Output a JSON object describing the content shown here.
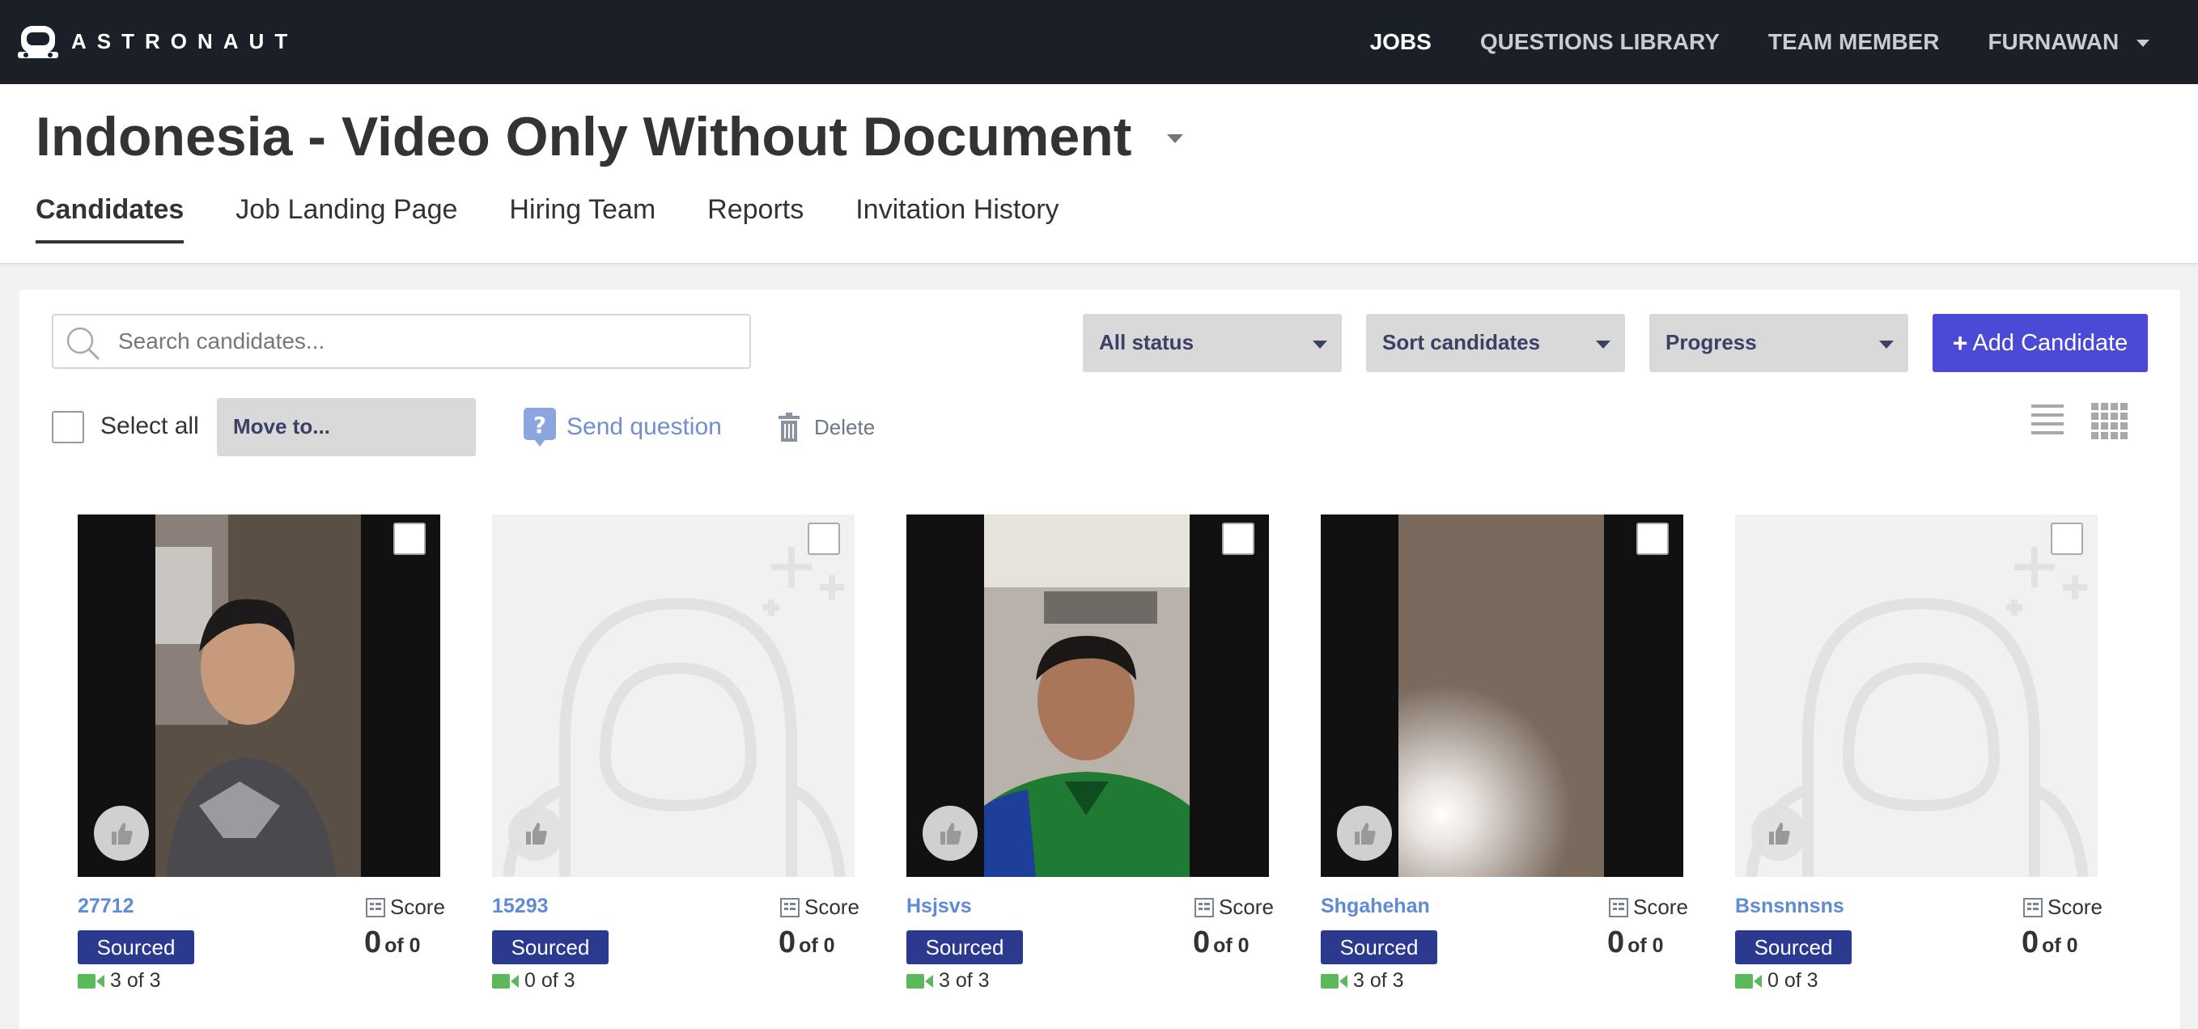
{
  "app": {
    "brand": "ASTRONAUT"
  },
  "nav": {
    "items": [
      "JOBS",
      "QUESTIONS LIBRARY",
      "TEAM MEMBER",
      "FURNAWAN"
    ]
  },
  "job": {
    "title": "Indonesia - Video Only Without Document",
    "tabs": [
      "Candidates",
      "Job Landing Page",
      "Hiring Team",
      "Reports",
      "Invitation History"
    ]
  },
  "toolbar": {
    "search_placeholder": "Search candidates...",
    "status_select": "All status",
    "sort_select": "Sort candidates",
    "progress_select": "Progress",
    "add_label": "Add Candidate",
    "add_icon": "+",
    "select_all": "Select all",
    "move_to": "Move to...",
    "send_question": "Send question",
    "delete": "Delete"
  },
  "candidates": [
    {
      "name": "27712",
      "status": "Sourced",
      "videos": "3 of 3",
      "score_label": "Score",
      "score": "0",
      "score_of": "of 0",
      "has_photo": true
    },
    {
      "name": "15293",
      "status": "Sourced",
      "videos": "0 of 3",
      "score_label": "Score",
      "score": "0",
      "score_of": "of 0",
      "has_photo": false
    },
    {
      "name": "Hsjsvs",
      "status": "Sourced",
      "videos": "3 of 3",
      "score_label": "Score",
      "score": "0",
      "score_of": "of 0",
      "has_photo": true
    },
    {
      "name": "Shgahehan",
      "status": "Sourced",
      "videos": "3 of 3",
      "score_label": "Score",
      "score": "0",
      "score_of": "of 0",
      "has_photo": true
    },
    {
      "name": "Bsnsnnsns",
      "status": "Sourced",
      "videos": "0 of 3",
      "score_label": "Score",
      "score": "0",
      "score_of": "of 0",
      "has_photo": false
    }
  ],
  "colors": {
    "nav_bg": "#1b1f27",
    "accent": "#4a4ad6",
    "badge": "#2b3a8f",
    "link": "#5f8ad4",
    "video_icon": "#5cb85c"
  }
}
